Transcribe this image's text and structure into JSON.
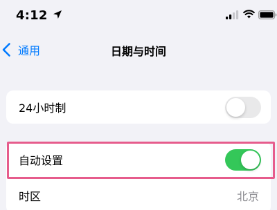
{
  "status_bar": {
    "time": "4:12",
    "icons": [
      "location-arrow-icon",
      "cellular-signal-icon",
      "wifi-icon",
      "battery-icon"
    ]
  },
  "nav": {
    "back_label": "通用",
    "title": "日期与时间"
  },
  "settings": {
    "hour24": {
      "label": "24小时制",
      "enabled": false
    },
    "auto_set": {
      "label": "自动设置",
      "enabled": true
    },
    "timezone": {
      "label": "时区",
      "value": "北京"
    }
  },
  "colors": {
    "accent": "#007aff",
    "toggle_on": "#34c759",
    "toggle_off": "#e9e9ea",
    "background": "#f2f2f7",
    "secondary_text": "#8e8e93",
    "highlight": "#e65c8c"
  }
}
